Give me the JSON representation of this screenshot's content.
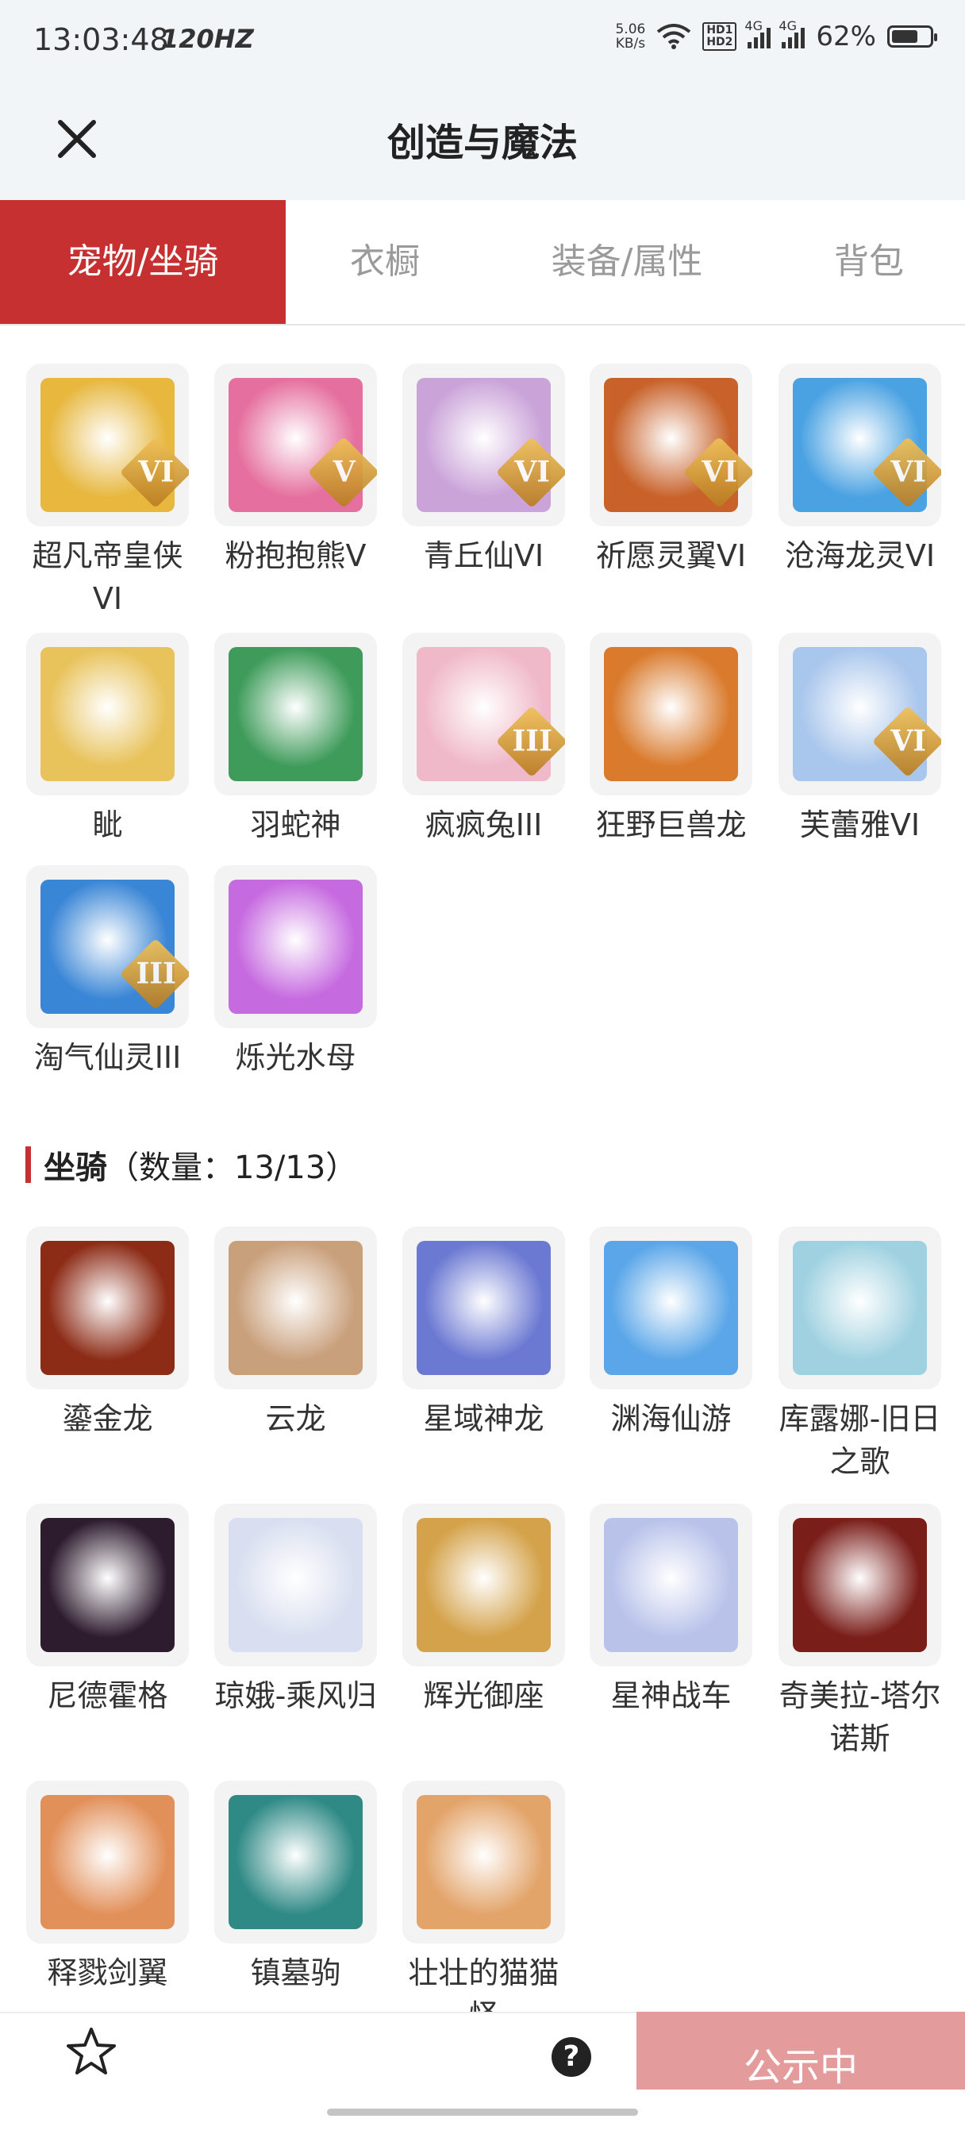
{
  "status_bar": {
    "time": "13:03:48",
    "refresh": "120HZ",
    "net_speed": "5.06",
    "net_unit": "KB/s",
    "hd1": "HD1",
    "hd2": "HD2",
    "sig1": "4G",
    "sig2": "4G",
    "battery": "62%"
  },
  "header": {
    "title": "创造与魔法"
  },
  "tabs": [
    {
      "label": "宠物/坐骑",
      "active": true
    },
    {
      "label": "衣橱"
    },
    {
      "label": "装备/属性"
    },
    {
      "label": "背包"
    }
  ],
  "pets": [
    {
      "name": "超凡帝皇侠VI",
      "badge": "VI",
      "color": "#e7b73e"
    },
    {
      "name": "粉抱抱熊Ⅴ",
      "badge": "V",
      "color": "#e56f9e"
    },
    {
      "name": "青丘仙VI",
      "badge": "VI",
      "color": "#caa3d9"
    },
    {
      "name": "祈愿灵翼VI",
      "badge": "VI",
      "color": "#c8622a"
    },
    {
      "name": "沧海龙灵VI",
      "badge": "VI",
      "color": "#4aa2e2"
    },
    {
      "name": "眦",
      "badge": "",
      "color": "#e8c25a"
    },
    {
      "name": "羽蛇神",
      "badge": "",
      "color": "#3e9b5a"
    },
    {
      "name": "疯疯兔III",
      "badge": "III",
      "color": "#f0b9c9"
    },
    {
      "name": "狂野巨兽龙",
      "badge": "",
      "color": "#d97a2c"
    },
    {
      "name": "芙蕾雅VI",
      "badge": "VI",
      "color": "#a9c6ec"
    },
    {
      "name": "淘气仙灵III",
      "badge": "III",
      "color": "#3a86d6"
    },
    {
      "name": "烁光水母",
      "badge": "",
      "color": "#c66ae0"
    }
  ],
  "mounts_section": {
    "title": "坐骑",
    "count": "（数量：13/13）"
  },
  "mounts": [
    {
      "name": "鎏金龙",
      "color": "#8c2b16"
    },
    {
      "name": "云龙",
      "color": "#c9a07c"
    },
    {
      "name": "星域神龙",
      "color": "#6b79d2"
    },
    {
      "name": "渊海仙游",
      "color": "#5aa6e8"
    },
    {
      "name": "库露娜-旧日之歌",
      "color": "#9fd1e0"
    },
    {
      "name": "尼德霍格",
      "color": "#2d1b2e"
    },
    {
      "name": "琼娥-乘风归",
      "color": "#d9dff0"
    },
    {
      "name": "辉光御座",
      "color": "#d4a24a"
    },
    {
      "name": "星神战车",
      "color": "#b9c3ea"
    },
    {
      "name": "奇美拉-塔尔诺斯",
      "color": "#7a1e1a"
    },
    {
      "name": "释戮剑翼",
      "color": "#e2905a"
    },
    {
      "name": "镇墓驹",
      "color": "#2f8a86"
    },
    {
      "name": "壮壮的猫猫怪",
      "color": "#e3a46a"
    }
  ],
  "bottom_bar": {
    "favorite_label": "收藏",
    "help": "?",
    "public_button": "公示中"
  },
  "colors": {
    "accent": "#c63030",
    "public_button": "#e49b9b",
    "header_bg": "#f1f5f8"
  }
}
